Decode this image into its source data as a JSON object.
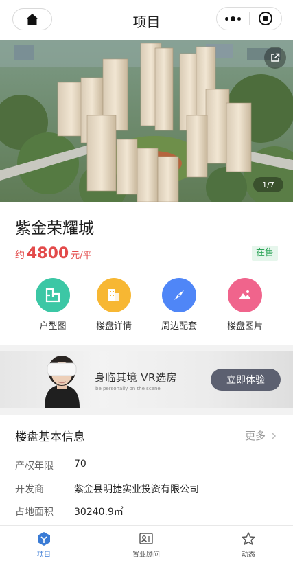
{
  "header": {
    "title": "项目",
    "home_icon": "home-icon",
    "more_icon": "more-dots-icon",
    "close_icon": "target-circle-icon"
  },
  "hero": {
    "image": "residential-complex-aerial-rendering",
    "share_icon": "share-external-icon",
    "counter": "1/7"
  },
  "project": {
    "name": "紫金荣耀城",
    "price_prefix": "约",
    "price_value": "4800",
    "price_unit": "元/平",
    "status": "在售"
  },
  "features": [
    {
      "label": "户型图",
      "icon": "floorplan-icon",
      "color": "#3cc7a5"
    },
    {
      "label": "楼盘详情",
      "icon": "building-icon",
      "color": "#f7b733"
    },
    {
      "label": "周边配套",
      "icon": "compass-icon",
      "color": "#4f86f7"
    },
    {
      "label": "楼盘图片",
      "icon": "picture-icon",
      "color": "#f0648c"
    }
  ],
  "vr_banner": {
    "title": "身临其境 VR选房",
    "subtitle": "be personally on the scene",
    "button": "立即体验"
  },
  "basic_info": {
    "title": "楼盘基本信息",
    "more": "更多",
    "rows": [
      {
        "key": "产权年限",
        "value": "70"
      },
      {
        "key": "开发商",
        "value": "紫金县明捷实业投资有限公司"
      },
      {
        "key": "占地面积",
        "value": "30240.9㎡"
      }
    ]
  },
  "tabbar": {
    "active_color": "#3a7bd5",
    "tabs": [
      {
        "label": "项目",
        "icon": "project-icon",
        "active": true
      },
      {
        "label": "置业顾问",
        "icon": "consultant-card-icon",
        "active": false
      },
      {
        "label": "动态",
        "icon": "star-icon",
        "active": false
      }
    ]
  }
}
